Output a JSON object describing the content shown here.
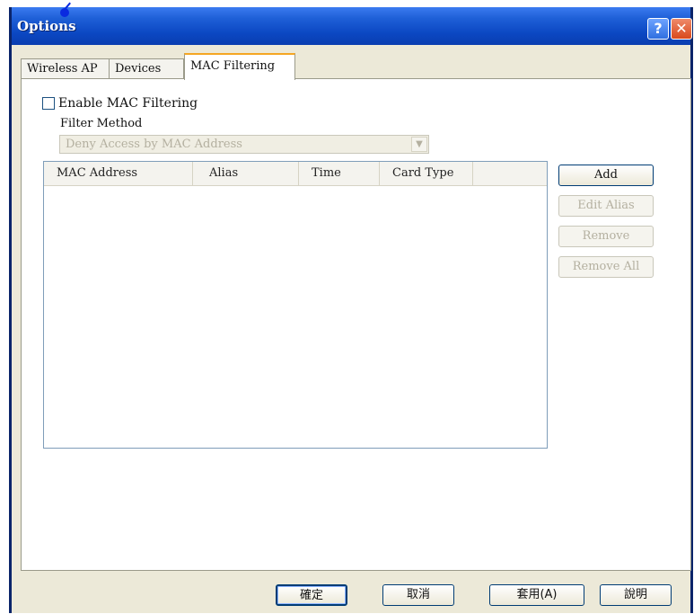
{
  "window": {
    "title": "Options"
  },
  "title_buttons": {
    "help": "?",
    "close": "✕"
  },
  "tabs": [
    {
      "label": "Wireless AP"
    },
    {
      "label": "Devices"
    },
    {
      "label": "MAC Filtering",
      "active": true
    }
  ],
  "mac_filtering": {
    "enable_label": "Enable MAC Filtering",
    "enabled": false,
    "filter_method_label": "Filter Method",
    "filter_method_value": "Deny Access by MAC Address",
    "columns": [
      "MAC Address",
      "Alias",
      "Time",
      "Card Type"
    ],
    "rows": []
  },
  "side_buttons": {
    "add": "Add",
    "edit_alias": "Edit Alias",
    "remove": "Remove",
    "remove_all": "Remove All"
  },
  "footer_buttons": {
    "ok": "確定",
    "cancel": "取消",
    "apply": "套用(A)",
    "help": "說明"
  },
  "colors": {
    "titlebar": "#0a47c2",
    "active_tab_accent": "#f5a623",
    "disabled_text": "#b4b0a0"
  }
}
